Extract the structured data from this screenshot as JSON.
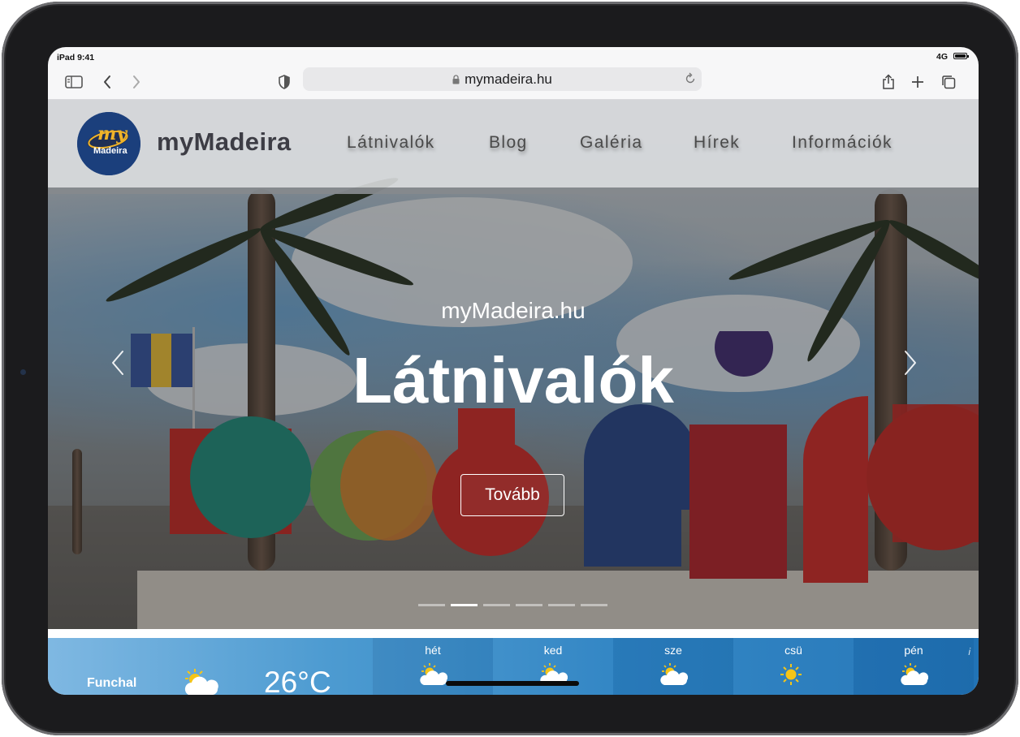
{
  "status_bar": {
    "device_time": "iPad 9:41",
    "network": "4G"
  },
  "browser": {
    "url": "mymadeira.hu"
  },
  "site": {
    "logo_top": "my",
    "logo_bottom": "Madeira",
    "brand": "myMadeira",
    "nav": [
      "Látnivalók",
      "Blog",
      "Galéria",
      "Hírek",
      "Információk"
    ]
  },
  "hero": {
    "subtitle": "myMadeira.hu",
    "title": "Látnivalók",
    "button": "Tovább",
    "slide_count": 6,
    "active_slide": 2
  },
  "weather": {
    "city": "Funchal",
    "temperature": "26°C",
    "current_icon": "partly-cloudy-icon",
    "forecast": [
      {
        "day": "hét",
        "icon": "partly-cloudy-icon"
      },
      {
        "day": "ked",
        "icon": "partly-cloudy-icon"
      },
      {
        "day": "sze",
        "icon": "partly-cloudy-icon"
      },
      {
        "day": "csü",
        "icon": "sun-icon"
      },
      {
        "day": "pén",
        "icon": "partly-cloudy-icon"
      }
    ],
    "info": "i"
  },
  "colors": {
    "logo_bg": "#1b3f7c",
    "weather_blue": "#2e84c4"
  }
}
